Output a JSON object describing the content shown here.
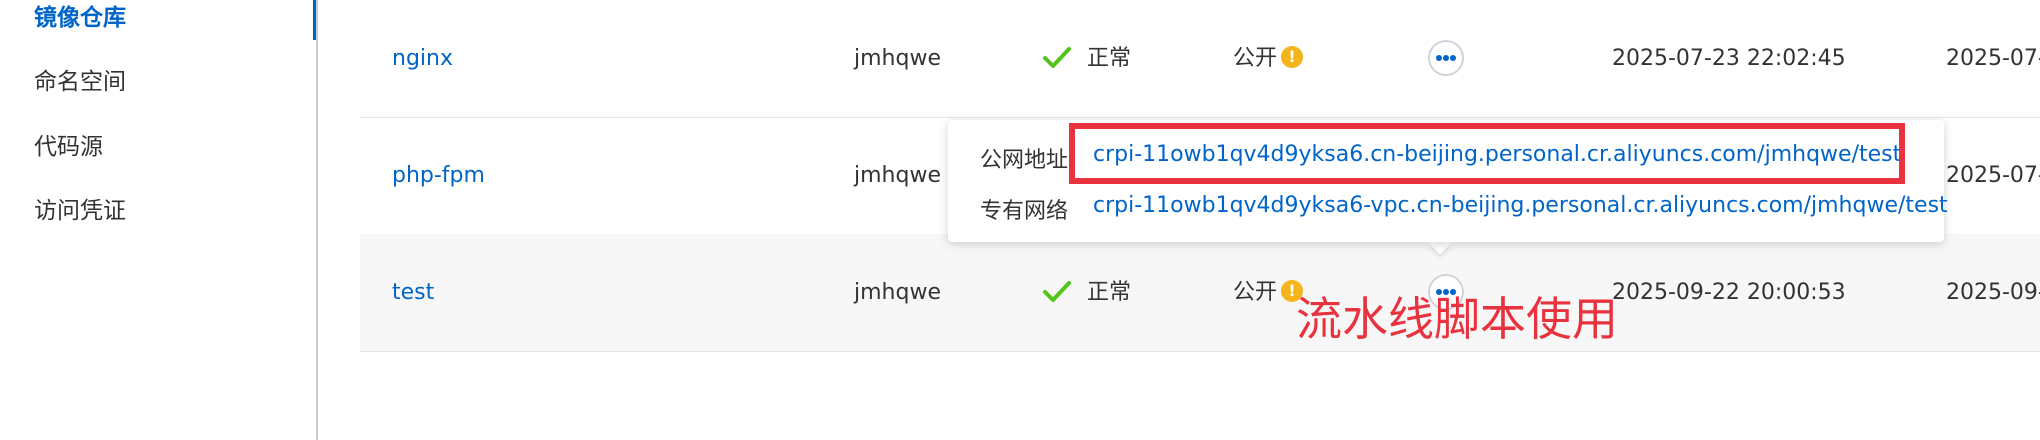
{
  "sidebar": {
    "items": [
      {
        "label": "镜像仓库",
        "active": true
      },
      {
        "label": "命名空间",
        "active": false
      },
      {
        "label": "代码源",
        "active": false
      },
      {
        "label": "访问凭证",
        "active": false
      }
    ]
  },
  "repos": [
    {
      "name": "nginx",
      "namespace": "jmhqwe",
      "status": "正常",
      "visibility": "公开",
      "created": "2025-07-23 22:02:45",
      "updated": "2025-07-"
    },
    {
      "name": "php-fpm",
      "namespace": "jmhqwe",
      "updated": "2025-07-"
    },
    {
      "name": "test",
      "namespace": "jmhqwe",
      "status": "正常",
      "visibility": "公开",
      "created": "2025-09-22 20:00:53",
      "updated": "2025-09-"
    }
  ],
  "popover": {
    "public_label": "公网地址",
    "public_url": "crpi-11owb1qv4d9yksa6.cn-beijing.personal.cr.aliyuncs.com/jmhqwe/test",
    "vpc_label": "专有网络",
    "vpc_url": "crpi-11owb1qv4d9yksa6-vpc.cn-beijing.personal.cr.aliyuncs.com/jmhqwe/test"
  },
  "annotation": {
    "text": "流水线脚本使用",
    "color": "#e8323e"
  },
  "colors": {
    "link": "#0064c8",
    "success": "#52c41a",
    "warning": "#f5b31c",
    "highlight": "#e8323e"
  },
  "icons": {
    "status": "check-icon",
    "visibility": "info-icon",
    "actions": "more-icon"
  }
}
